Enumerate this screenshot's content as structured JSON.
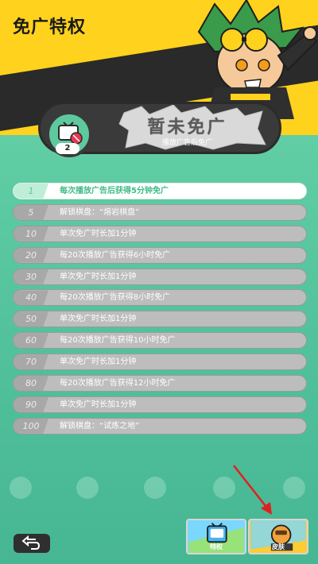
{
  "header": {
    "title": "免广特权"
  },
  "status": {
    "title": "暂未免广",
    "subtitle": "播放广告后免广",
    "level": "2"
  },
  "privileges": [
    {
      "level": "1",
      "text": "每次播放广告后获得5分钟免广",
      "active": true
    },
    {
      "level": "5",
      "text": "解锁棋盘：“熔岩棋盘”",
      "active": false
    },
    {
      "level": "10",
      "text": "单次免广时长加1分钟",
      "active": false
    },
    {
      "level": "20",
      "text": "每20次播放广告获得6小时免广",
      "active": false
    },
    {
      "level": "30",
      "text": "单次免广时长加1分钟",
      "active": false
    },
    {
      "level": "40",
      "text": "每20次播放广告获得8小时免广",
      "active": false
    },
    {
      "level": "50",
      "text": "单次免广时长加1分钟",
      "active": false
    },
    {
      "level": "60",
      "text": "每20次播放广告获得10小时免广",
      "active": false
    },
    {
      "level": "70",
      "text": "单次免广时长加1分钟",
      "active": false
    },
    {
      "level": "80",
      "text": "每20次播放广告获得12小时免广",
      "active": false
    },
    {
      "level": "90",
      "text": "单次免广时长加1分钟",
      "active": false
    },
    {
      "level": "100",
      "text": "解锁棋盘：“试炼之地”",
      "active": false
    }
  ],
  "bottom_tabs": [
    {
      "label": "特权",
      "icon": "tv-icon",
      "bg": "#7ad8ff"
    },
    {
      "label": "皮肤",
      "icon": "avatar-icon",
      "bg": "#ffcc33"
    }
  ],
  "colors": {
    "banner": "#ffd21e",
    "background": "#5ccaa2",
    "active_text": "#3fbd86",
    "arrow": "#e02020"
  }
}
